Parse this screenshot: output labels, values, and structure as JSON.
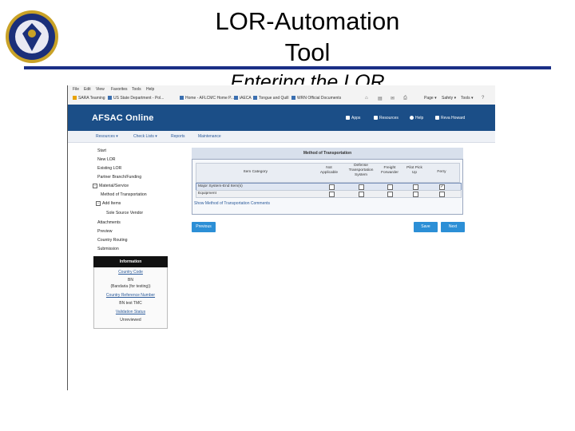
{
  "slide": {
    "title_line1": "LOR-Automation",
    "title_line2": "Tool",
    "title_line3": "Entering the LOR",
    "accent_color": "#1a2f86"
  },
  "browser": {
    "menu": [
      "File",
      "Edit",
      "View",
      "Favorites",
      "Tools",
      "Help"
    ],
    "favorites": [
      "SARA Teaming",
      "US State Department - Pol...",
      "Home - AFLCMC Home P...",
      "iAECA",
      "Tongue and Quill",
      "WRN Official Documents"
    ],
    "toolbar": [
      "Page ▾",
      "Safety ▾",
      "Tools ▾"
    ]
  },
  "app": {
    "logo": "AFSAC Online",
    "header_links": [
      "Apps",
      "Resources",
      "Help",
      "Reva Howard"
    ],
    "header_color": "#1b4e87",
    "tabs": [
      "Resources ▾",
      "Check Lists ▾",
      "Reports",
      "Maintenance"
    ],
    "sidebar": [
      "Start",
      "New LOR",
      "Existing LOR",
      "Partner Branch/Funding",
      "Material/Service",
      "Method of Transportation",
      "Add Items",
      "Sole Source Vendor",
      "Attachments",
      "Preview",
      "Country Routing",
      "Submission"
    ],
    "info": {
      "header": "Information",
      "country_code_label": "Country Code",
      "country_code_value": "BN",
      "country_code_note": "(Bandaria (for testing))",
      "crn_label": "Country Reference Number",
      "crn_value": "BN test TMC",
      "validation_label": "Validation Status",
      "validation_value": "Unreviewed"
    },
    "mot": {
      "title": "Method of Transportation",
      "columns": [
        "Item Category",
        "Not Applicable",
        "Defense Transportation System",
        "Freight Forwarder",
        "Pilot Pick Up",
        "Ferry"
      ],
      "rows": [
        {
          "category": "Major System-End Item(s)",
          "checks": [
            false,
            false,
            false,
            false,
            true
          ]
        },
        {
          "category": "Equipment",
          "checks": [
            false,
            false,
            false,
            false,
            false
          ]
        }
      ],
      "show_comments": "Show Method of Transportation Comments"
    },
    "buttons": {
      "previous": "Previous",
      "save": "Save",
      "next": "Next"
    },
    "button_color": "#2c8fd6"
  }
}
